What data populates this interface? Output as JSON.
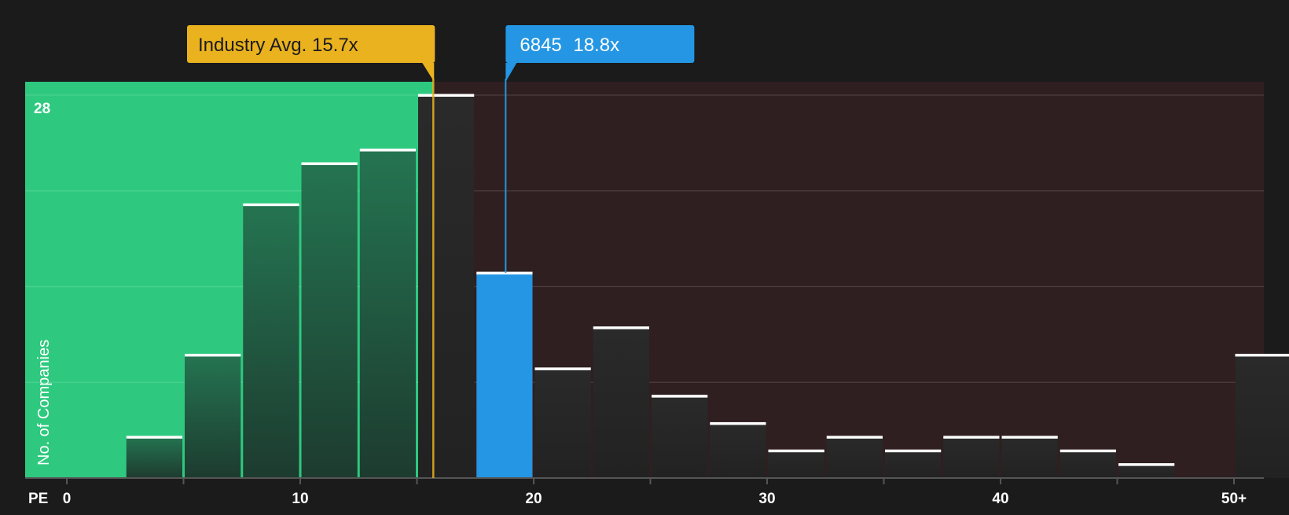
{
  "colors": {
    "background": "#1b1b1c",
    "below_zone": "#2ec97f",
    "above_zone": "#2f1f20",
    "industry": "#eab21e",
    "company": "#2496e3",
    "bar_green_top": "#247451",
    "bar_green_bottom": "#1d3b2f",
    "bar_dark": "#262626",
    "bar_cap": "#ffffff",
    "axis_text": "#ffffff"
  },
  "chart_data": {
    "type": "bar",
    "xlabel": "PE",
    "ylabel": "No. of Companies",
    "y_max_label": "28",
    "ylim": [
      0,
      28
    ],
    "xlim": [
      0,
      51.25
    ],
    "grid": true,
    "x_ticks": [
      {
        "value": 0,
        "label": "0"
      },
      {
        "value": 10,
        "label": "10"
      },
      {
        "value": 20,
        "label": "20"
      },
      {
        "value": 30,
        "label": "30"
      },
      {
        "value": 40,
        "label": "40"
      },
      {
        "value": 50,
        "label": "50+"
      }
    ],
    "bin_width": 2.5,
    "bins": [
      {
        "start": 0,
        "count": 0
      },
      {
        "start": 2.5,
        "count": 3
      },
      {
        "start": 5,
        "count": 9
      },
      {
        "start": 7.5,
        "count": 20
      },
      {
        "start": 10,
        "count": 23
      },
      {
        "start": 12.5,
        "count": 24
      },
      {
        "start": 15,
        "count": 28
      },
      {
        "start": 17.5,
        "count": 15,
        "highlight": true
      },
      {
        "start": 20,
        "count": 8
      },
      {
        "start": 22.5,
        "count": 11
      },
      {
        "start": 25,
        "count": 6
      },
      {
        "start": 27.5,
        "count": 4
      },
      {
        "start": 30,
        "count": 2
      },
      {
        "start": 32.5,
        "count": 3
      },
      {
        "start": 35,
        "count": 2
      },
      {
        "start": 37.5,
        "count": 3
      },
      {
        "start": 40,
        "count": 3
      },
      {
        "start": 42.5,
        "count": 2
      },
      {
        "start": 45,
        "count": 1
      },
      {
        "start": 47.5,
        "count": 0
      },
      {
        "start": 50,
        "count": 9
      }
    ],
    "industry_avg": {
      "value": 15.7,
      "label": "Industry Avg. 15.7x"
    },
    "company": {
      "value": 18.8,
      "ticker": "6845",
      "multiple": "18.8x"
    }
  }
}
